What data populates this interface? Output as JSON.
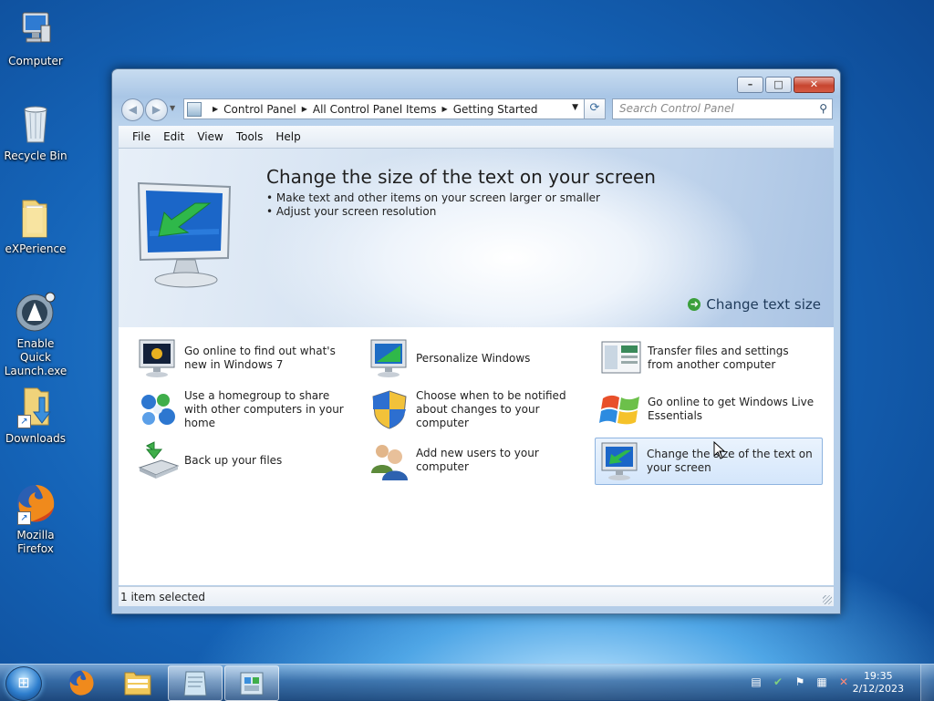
{
  "desktop": {
    "icons": [
      {
        "label": "Computer"
      },
      {
        "label": "Recycle Bin"
      },
      {
        "label": "eXPerience"
      },
      {
        "label": "Enable Quick Launch.exe"
      },
      {
        "label": "Downloads"
      },
      {
        "label": "Mozilla Firefox"
      }
    ]
  },
  "window": {
    "breadcrumbs": [
      "Control Panel",
      "All Control Panel Items",
      "Getting Started"
    ],
    "search_placeholder": "Search Control Panel",
    "menu": [
      "File",
      "Edit",
      "View",
      "Tools",
      "Help"
    ],
    "banner": {
      "title": "Change the size of the text on your screen",
      "bullets": [
        "Make text and other items on your screen larger or smaller",
        "Adjust your screen resolution"
      ],
      "link": "Change text size"
    },
    "tasks": [
      {
        "label": "Go online to find out what's new in Windows 7",
        "icon": "monitor-windows7-icon"
      },
      {
        "label": "Personalize Windows",
        "icon": "personalize-monitor-icon"
      },
      {
        "label": "Transfer files and settings from another computer",
        "icon": "transfer-icon"
      },
      {
        "label": "Use a homegroup to share with other computers in your home",
        "icon": "homegroup-icon"
      },
      {
        "label": "Choose when to be notified about changes to your computer",
        "icon": "uac-shield-icon"
      },
      {
        "label": "Go online to get Windows Live Essentials",
        "icon": "windows-flag-icon"
      },
      {
        "label": "Back up your files",
        "icon": "backup-icon"
      },
      {
        "label": "Add new users to your computer",
        "icon": "users-icon"
      },
      {
        "label": "Change the size of the text on your screen",
        "icon": "text-size-monitor-icon",
        "selected": true
      }
    ],
    "status": "1 item selected"
  },
  "taskbar": {
    "clock_time": "19:35",
    "clock_date": "2/12/2023"
  },
  "colors": {
    "accent": "#2b86d6",
    "selection": "#d4e6fb",
    "link": "#1e3a5a"
  }
}
